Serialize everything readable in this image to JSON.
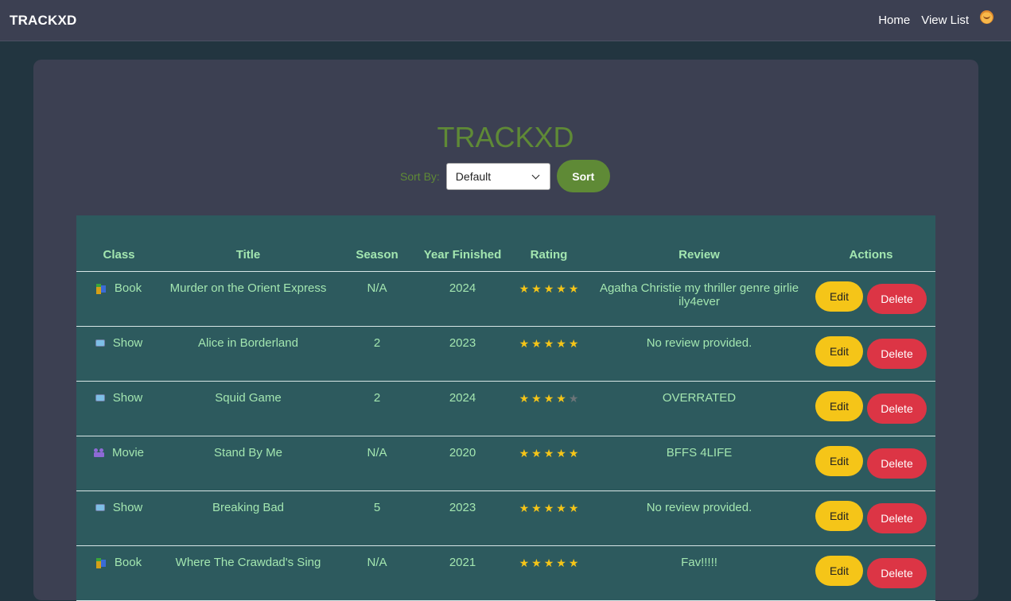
{
  "nav": {
    "brand": "TRACKXD",
    "home": "Home",
    "view_list": "View List",
    "avatar_icon": "smiley-sun-icon"
  },
  "page": {
    "title": "TRACKXD"
  },
  "sort": {
    "label": "Sort By:",
    "selected": "Default",
    "button": "Sort"
  },
  "table": {
    "headers": {
      "class": "Class",
      "title": "Title",
      "season": "Season",
      "year": "Year Finished",
      "rating": "Rating",
      "review": "Review",
      "actions": "Actions"
    },
    "edit_label": "Edit",
    "delete_label": "Delete",
    "rows": [
      {
        "class": "Book",
        "icon": "book-icon",
        "title": "Murder on the Orient Express",
        "season": "N/A",
        "year": "2024",
        "rating": 5,
        "review": "Agatha Christie my thriller genre girlie ily4ever"
      },
      {
        "class": "Show",
        "icon": "tv-icon",
        "title": "Alice in Borderland",
        "season": "2",
        "year": "2023",
        "rating": 5,
        "review": "No review provided."
      },
      {
        "class": "Show",
        "icon": "tv-icon",
        "title": "Squid Game",
        "season": "2",
        "year": "2024",
        "rating": 4,
        "review": "OVERRATED"
      },
      {
        "class": "Movie",
        "icon": "movie-icon",
        "title": "Stand By Me",
        "season": "N/A",
        "year": "2020",
        "rating": 5,
        "review": "BFFS 4LIFE"
      },
      {
        "class": "Show",
        "icon": "tv-icon",
        "title": "Breaking Bad",
        "season": "5",
        "year": "2023",
        "rating": 5,
        "review": "No review provided."
      },
      {
        "class": "Book",
        "icon": "book-icon",
        "title": "Where The Crawdad's Sing",
        "season": "N/A",
        "year": "2021",
        "rating": 5,
        "review": "Fav!!!!!"
      }
    ]
  },
  "colors": {
    "accent_green": "#5f8a36",
    "table_bg": "#2d5a5e",
    "edit": "#f5c518",
    "delete": "#dc3545"
  }
}
